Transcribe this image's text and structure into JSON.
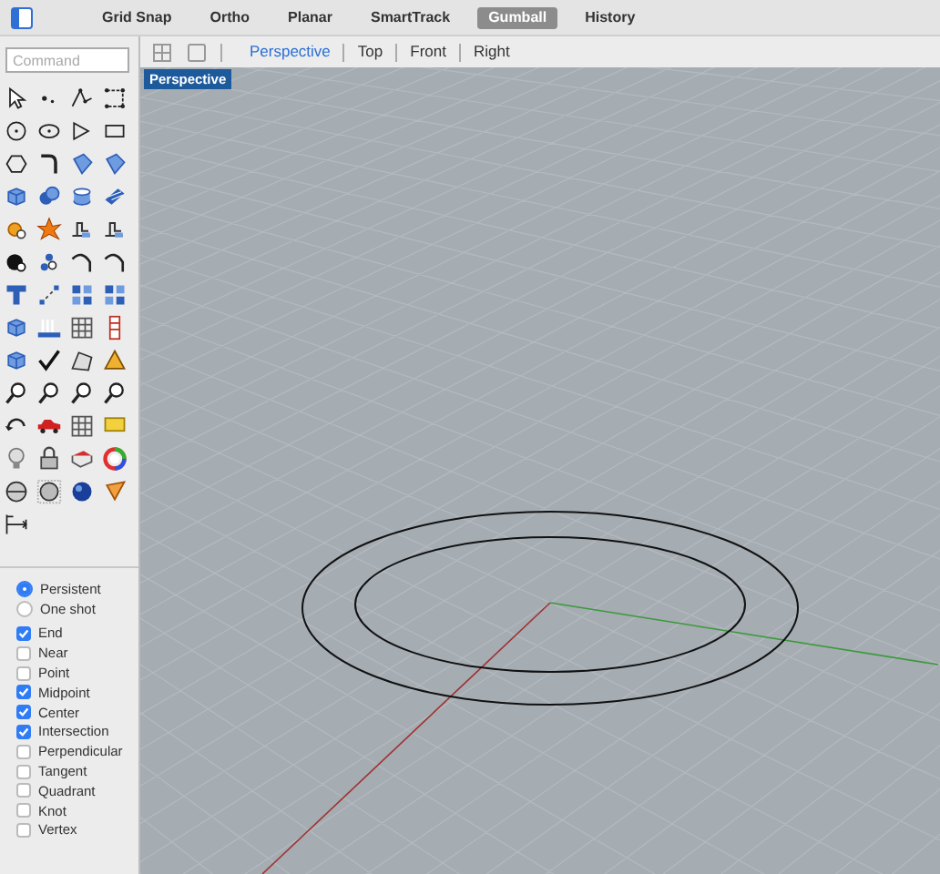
{
  "top_bar": {
    "toggles": [
      {
        "label": "Grid Snap",
        "on": false
      },
      {
        "label": "Ortho",
        "on": false
      },
      {
        "label": "Planar",
        "on": false
      },
      {
        "label": "SmartTrack",
        "on": false
      },
      {
        "label": "Gumball",
        "on": true
      },
      {
        "label": "History",
        "on": false
      }
    ]
  },
  "viewport_tabs": [
    {
      "label": "Perspective",
      "selected": true
    },
    {
      "label": "Top",
      "selected": false
    },
    {
      "label": "Front",
      "selected": false
    },
    {
      "label": "Right",
      "selected": false
    }
  ],
  "command": {
    "placeholder": "Command"
  },
  "viewport": {
    "label": "Perspective"
  },
  "osnap_mode": [
    {
      "label": "Persistent",
      "selected": true
    },
    {
      "label": "One shot",
      "selected": false
    }
  ],
  "osnaps": [
    {
      "label": "End",
      "checked": true
    },
    {
      "label": "Near",
      "checked": false
    },
    {
      "label": "Point",
      "checked": false
    },
    {
      "label": "Midpoint",
      "checked": true
    },
    {
      "label": "Center",
      "checked": true
    },
    {
      "label": "Intersection",
      "checked": true
    },
    {
      "label": "Perpendicular",
      "checked": false
    },
    {
      "label": "Tangent",
      "checked": false
    },
    {
      "label": "Quadrant",
      "checked": false
    },
    {
      "label": "Knot",
      "checked": false
    },
    {
      "label": "Vertex",
      "checked": false
    }
  ]
}
